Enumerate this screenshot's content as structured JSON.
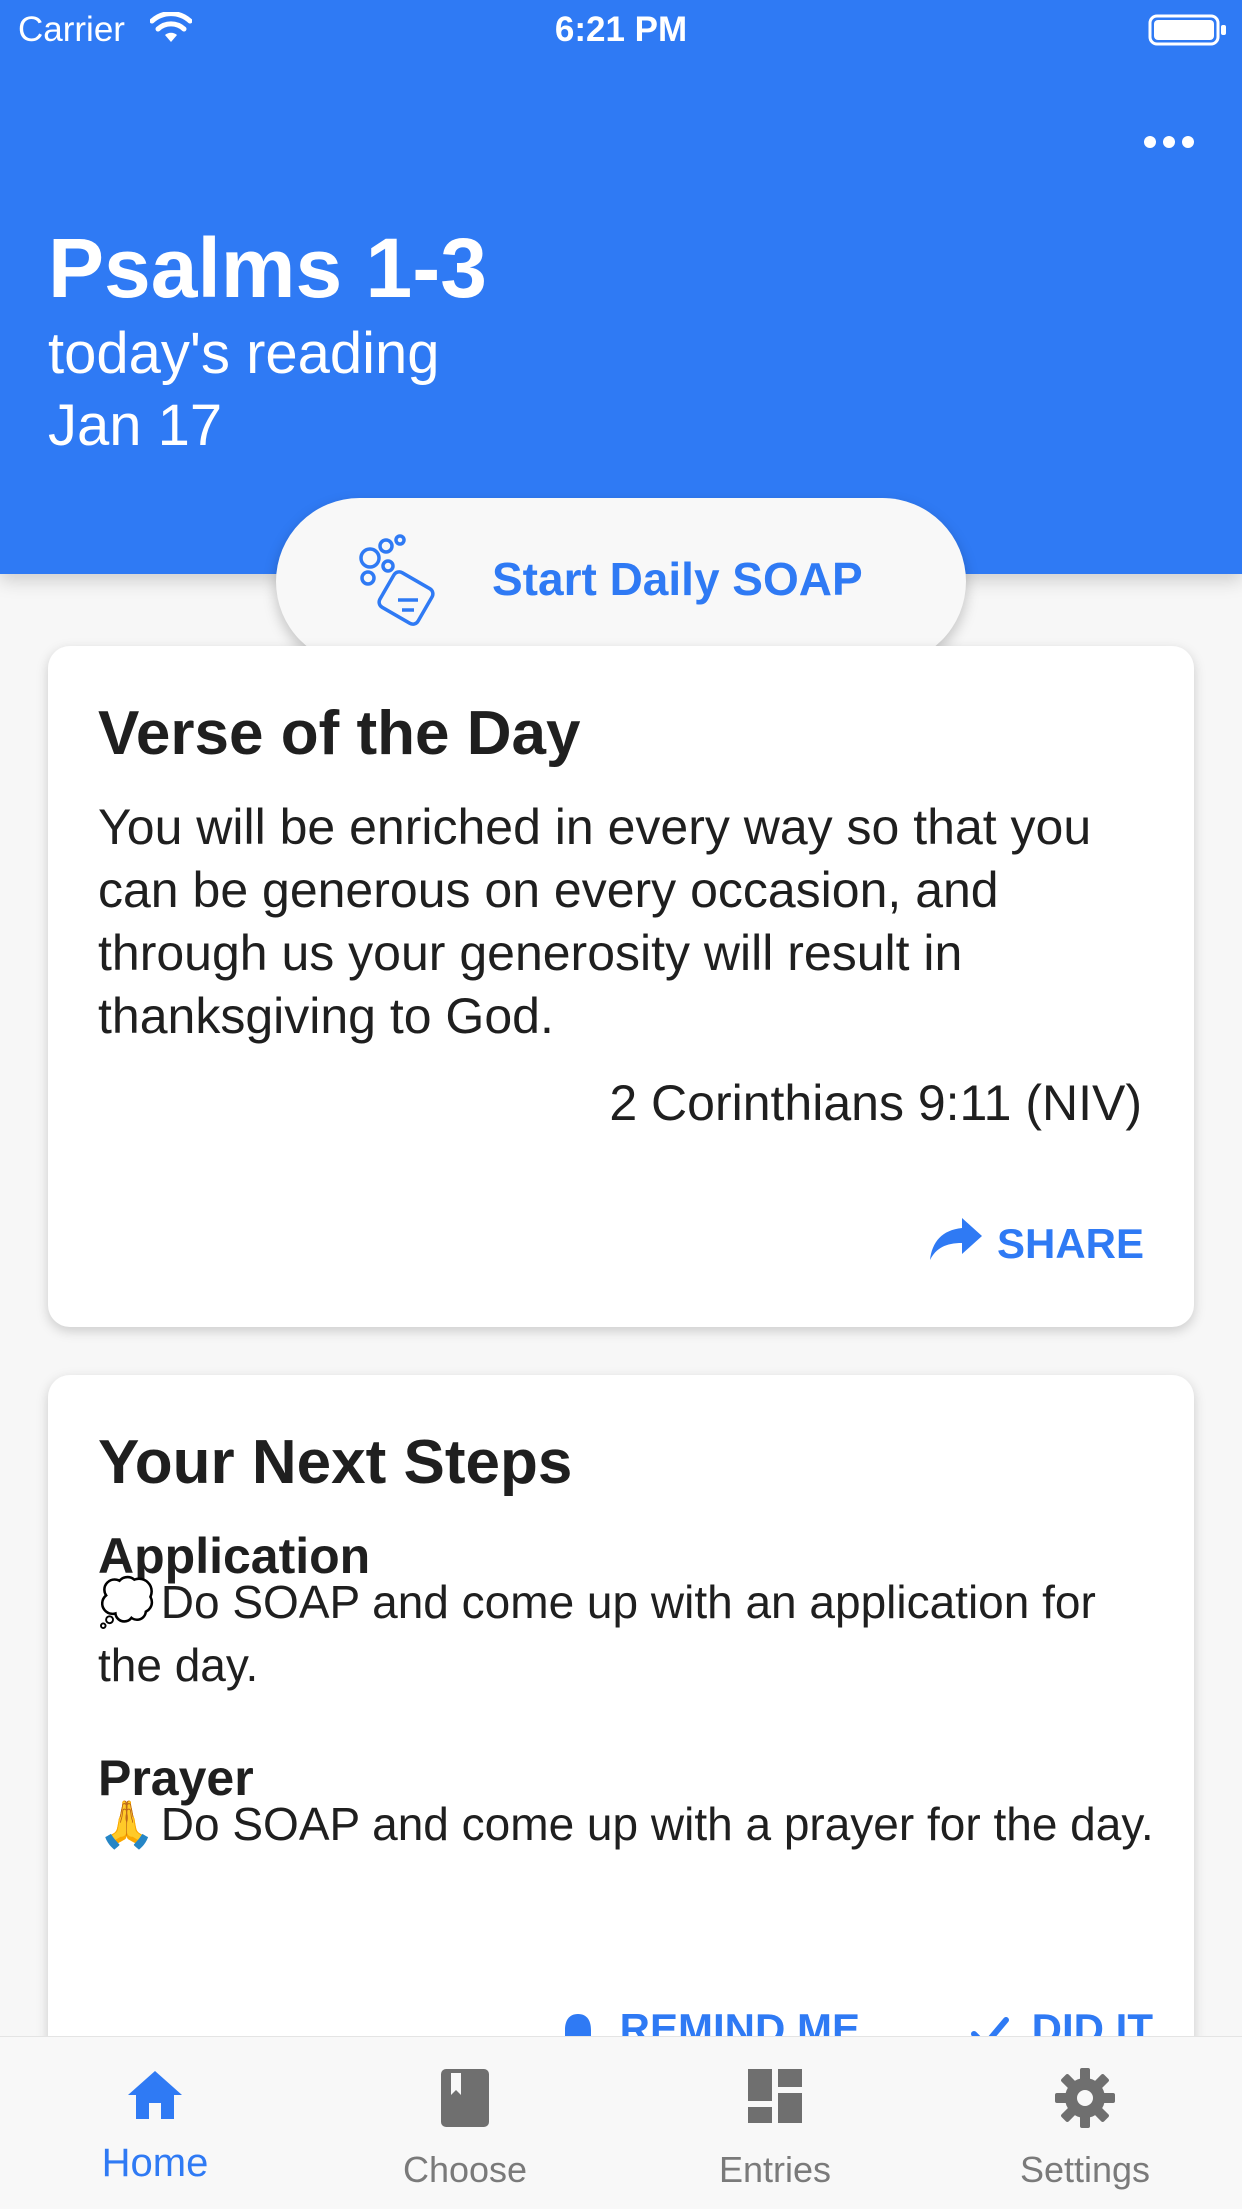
{
  "status_bar": {
    "carrier": "Carrier",
    "time": "6:21 PM"
  },
  "header": {
    "title": "Psalms 1-3",
    "subtitle": "today's reading",
    "date": "Jan 17",
    "accent_color": "#2f7af4"
  },
  "soap_button": {
    "label": "Start Daily SOAP",
    "icon": "soap-icon"
  },
  "verse_card": {
    "title": "Verse of the Day",
    "text": "You will be enriched in every way so that you can be generous on every occasion, and through us your generosity will result in thanksgiving to God.",
    "reference": "2 Corinthians 9:11 (NIV)",
    "share_label": "SHARE"
  },
  "next_steps_card": {
    "title": "Your Next Steps",
    "application_heading": "Application",
    "application_emoji": "💭",
    "application_text": "Do SOAP and come up with an application for the day.",
    "prayer_heading": "Prayer",
    "prayer_emoji": "🙏",
    "prayer_text": "Do SOAP and come up with a prayer for the day.",
    "remind_label": "REMIND ME",
    "did_it_label": "DID IT"
  },
  "tabbar": {
    "tabs": [
      {
        "label": "Home",
        "icon": "home-icon",
        "active": true
      },
      {
        "label": "Choose",
        "icon": "book-icon",
        "active": false
      },
      {
        "label": "Entries",
        "icon": "dashboard-icon",
        "active": false
      },
      {
        "label": "Settings",
        "icon": "gear-icon",
        "active": false
      }
    ]
  }
}
